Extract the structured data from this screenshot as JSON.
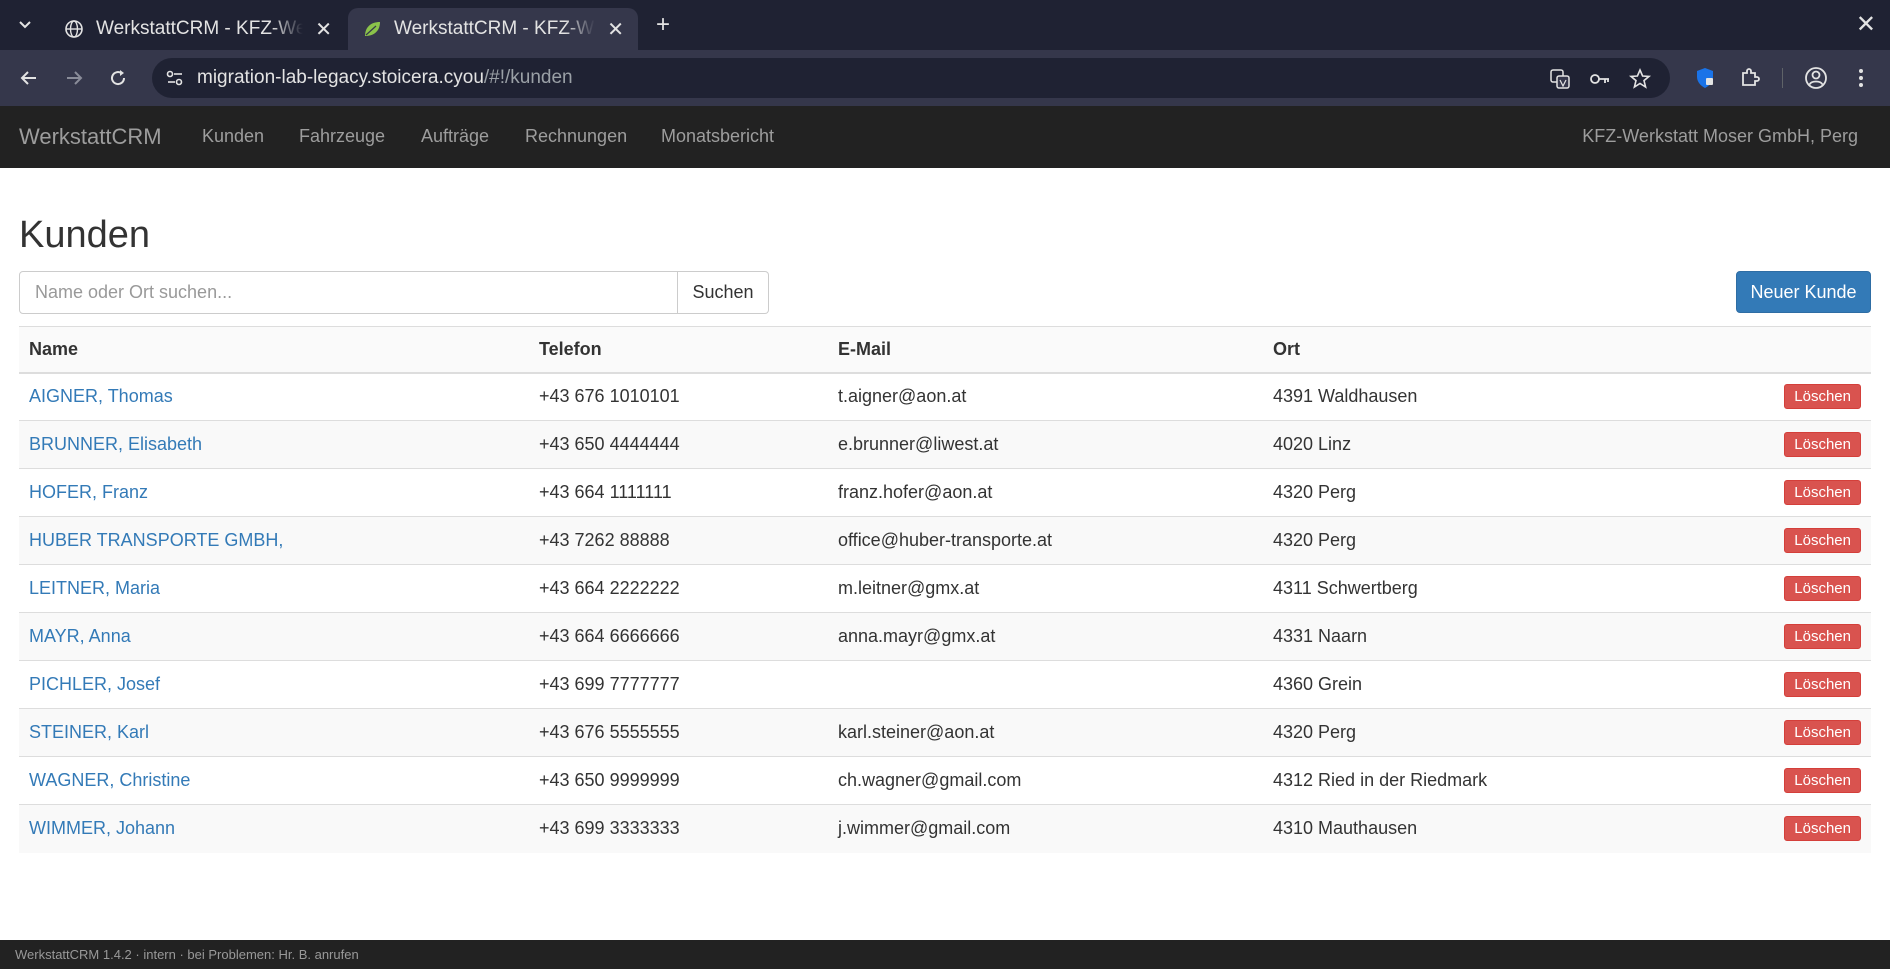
{
  "browser": {
    "tabs": [
      {
        "title": "WerkstattCRM - KFZ-Werkstatt Moser GmbH",
        "active": false
      },
      {
        "title": "WerkstattCRM - KFZ-Werkstatt Moser GmbH",
        "active": true
      }
    ],
    "url_host": "migration-lab-legacy.stoicera.cyou",
    "url_path": "/#!/kunden"
  },
  "navbar": {
    "brand": "WerkstattCRM",
    "links": [
      "Kunden",
      "Fahrzeuge",
      "Aufträge",
      "Rechnungen",
      "Monatsbericht"
    ],
    "right_text": "KFZ-Werkstatt Moser GmbH, Perg"
  },
  "page": {
    "title": "Kunden",
    "search_placeholder": "Name oder Ort suchen...",
    "search_button": "Suchen",
    "new_button": "Neuer Kunde"
  },
  "table": {
    "headers": [
      "Name",
      "Telefon",
      "E-Mail",
      "Ort"
    ],
    "delete_label": "Löschen",
    "rows": [
      {
        "name": "AIGNER, Thomas",
        "phone": "+43 676 1010101",
        "email": "t.aigner@aon.at",
        "city": "4391 Waldhausen"
      },
      {
        "name": "BRUNNER, Elisabeth",
        "phone": "+43 650 4444444",
        "email": "e.brunner@liwest.at",
        "city": "4020 Linz"
      },
      {
        "name": "HOFER, Franz",
        "phone": "+43 664 1111111",
        "email": "franz.hofer@aon.at",
        "city": "4320 Perg"
      },
      {
        "name": "HUBER TRANSPORTE GMBH,",
        "phone": "+43 7262 88888",
        "email": "office@huber-transporte.at",
        "city": "4320 Perg"
      },
      {
        "name": "LEITNER, Maria",
        "phone": "+43 664 2222222",
        "email": "m.leitner@gmx.at",
        "city": "4311 Schwertberg"
      },
      {
        "name": "MAYR, Anna",
        "phone": "+43 664 6666666",
        "email": "anna.mayr@gmx.at",
        "city": "4331 Naarn"
      },
      {
        "name": "PICHLER, Josef",
        "phone": "+43 699 7777777",
        "email": "",
        "city": "4360 Grein"
      },
      {
        "name": "STEINER, Karl",
        "phone": "+43 676 5555555",
        "email": "karl.steiner@aon.at",
        "city": "4320 Perg"
      },
      {
        "name": "WAGNER, Christine",
        "phone": "+43 650 9999999",
        "email": "ch.wagner@gmail.com",
        "city": "4312 Ried in der Riedmark"
      },
      {
        "name": "WIMMER, Johann",
        "phone": "+43 699 3333333",
        "email": "j.wimmer@gmail.com",
        "city": "4310 Mauthausen"
      }
    ]
  },
  "footer": {
    "text": "WerkstattCRM 1.4.2 · intern · bei Problemen: Hr. B. anrufen"
  }
}
